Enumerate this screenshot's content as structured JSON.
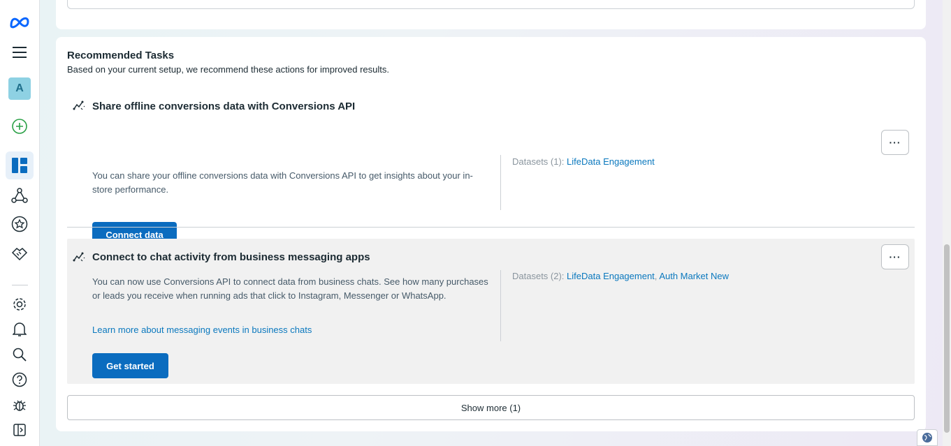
{
  "sidebar": {
    "avatar_letter": "A",
    "icons": [
      "meta-logo-icon",
      "menu-icon",
      "add-icon",
      "overview-icon",
      "network-icon",
      "star-icon",
      "handshake-icon",
      "settings-icon",
      "notifications-icon",
      "search-icon",
      "help-icon",
      "bug-icon",
      "collapse-sidebar-icon"
    ]
  },
  "recommended": {
    "title": "Recommended Tasks",
    "subtitle": "Based on your current setup, we recommend these actions for improved results.",
    "tasks": [
      {
        "title": "Share offline conversions data with Conversions API",
        "description": "You can share your offline conversions data with Conversions API to get insights about your in-store performance.",
        "datasets_label": "Datasets (1): ",
        "datasets": [
          "LifeData Engagement"
        ],
        "button": "Connect data",
        "more": "···"
      },
      {
        "title": "Connect to chat activity from business messaging apps",
        "description": "You can now use Conversions API to connect data from business chats. See how many purchases or leads you receive when running ads that click to Instagram, Messenger or WhatsApp.",
        "link": "Learn more about messaging events in business chats",
        "datasets_label": "Datasets (2): ",
        "datasets": [
          "LifeData Engagement",
          "Auth Market New"
        ],
        "dataset_separator": ", ",
        "button": "Get started",
        "more": "···"
      }
    ],
    "show_more": "Show more (1)"
  },
  "colors": {
    "accent": "#0b6cbf",
    "link": "#0a78be",
    "avatar_bg": "#8ed1e3"
  }
}
